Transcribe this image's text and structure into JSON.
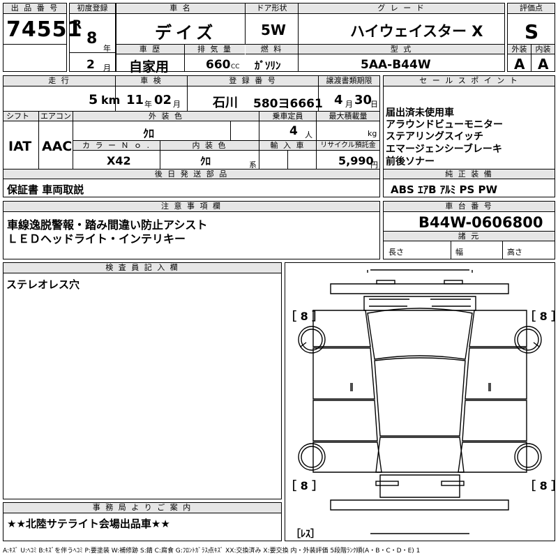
{
  "top": {
    "lot_label": "出 品 番 号",
    "lot_number": "74551",
    "first_reg_label": "初度登録",
    "era_letter": "R",
    "year": "8",
    "year_unit": "年",
    "month": "2",
    "month_unit": "月",
    "car_name_label": "車 名",
    "car_name": "デイズ",
    "history_label": "車 歴",
    "history": "自家用",
    "displacement_label": "排 気 量",
    "displacement": "660",
    "displacement_unit": "CC",
    "door_label": "ドア形状",
    "door": "5W",
    "fuel_label": "燃 料",
    "fuel": "ｶﾞｿﾘﾝ",
    "grade_label": "グ レ ー ド",
    "grade": "ハイウェイスター X",
    "model_label": "型 式",
    "model": "5AA-B44W",
    "score_label": "評価点",
    "score": "S",
    "exterior_label": "外装",
    "exterior": "A",
    "interior_label": "内装",
    "interior": "A"
  },
  "row2": {
    "mileage_label": "走 行",
    "mileage": "5",
    "mileage_unit": "km",
    "inspection_label": "車 検",
    "insp_year": "11",
    "insp_year_unit": "年",
    "insp_month": "02",
    "insp_month_unit": "月",
    "reg_label": "登 録 番 号",
    "reg_region": "石川",
    "reg_number": "580ヨ6661",
    "transfer_label": "譲渡書類期限",
    "transfer_month": "4",
    "transfer_month_unit": "月",
    "transfer_day": "30",
    "transfer_day_unit": "日",
    "shift_label": "シフト",
    "shift": "IAT",
    "ac_label": "エアコン",
    "ac": "AAC",
    "ext_color_label": "外 装 色",
    "ext_color": "ｸﾛ",
    "capacity_label": "乗車定員",
    "capacity": "4",
    "capacity_unit": "人",
    "load_label": "最大積載量",
    "load_unit": "kg",
    "color_no_label": "カ ラ ー Ｎ ｏ .",
    "color_no": "X42",
    "int_color_label": "内 装 色",
    "int_color": "ｸﾛ",
    "int_color_unit": "系",
    "import_label": "輸 入 車",
    "recycle_label": "リサイクル預託金",
    "recycle": "5,990",
    "recycle_unit": "円",
    "later_label": "後 日 発 送 部 品",
    "later": "保証書 車両取説"
  },
  "sales": {
    "label": "セ ー ル ス ポ イ ン ト",
    "lines": [
      "届出済未使用車",
      "アラウンドビューモニター",
      "ステアリングスイッチ",
      "エマージェンシーブレーキ",
      "前後ソナー"
    ],
    "equip_label": "純 正 装 備",
    "equip": "ABS ｴｱB ｱﾙﾐ PS PW"
  },
  "notes": {
    "label": "注 意 事 項 欄",
    "lines": [
      "車線逸脱警報・踏み間違い防止アシスト",
      "ＬＥＤヘッドライト・インテリキー"
    ]
  },
  "chassis": {
    "label": "車 台 番 号",
    "number": "B44W-0606800",
    "dims_label": "諸 元",
    "length_label": "長さ",
    "width_label": "幅",
    "height_label": "高さ"
  },
  "inspector": {
    "label": "検 査 員 記 入 欄",
    "text": "ステレオレス穴"
  },
  "office": {
    "label": "事 務 局 よ り ご 案 内",
    "text": "★★北陸サテライト会場出品車★★"
  },
  "diagram": {
    "tire_fl": "［ 8 ］",
    "tire_fr": "［ 8 ］",
    "tire_rl": "［ 8 ］",
    "tire_rr": "［ 8 ］",
    "spare": "［ﾚｽ］"
  },
  "legend": "A:ｷｽﾞ U:ﾍｺﾐ B:ｷｽﾞを伴うﾍｺﾐ P:要塗装 W:補修跡 S:錆 C:腐食 G:ﾌﾛﾝﾄｶﾞﾗｽ点ｷｽﾞ XX:交換済み X:要交換 内・外装評価 5段階ﾗﾝｸ順(A・B・C・D・E) 1"
}
